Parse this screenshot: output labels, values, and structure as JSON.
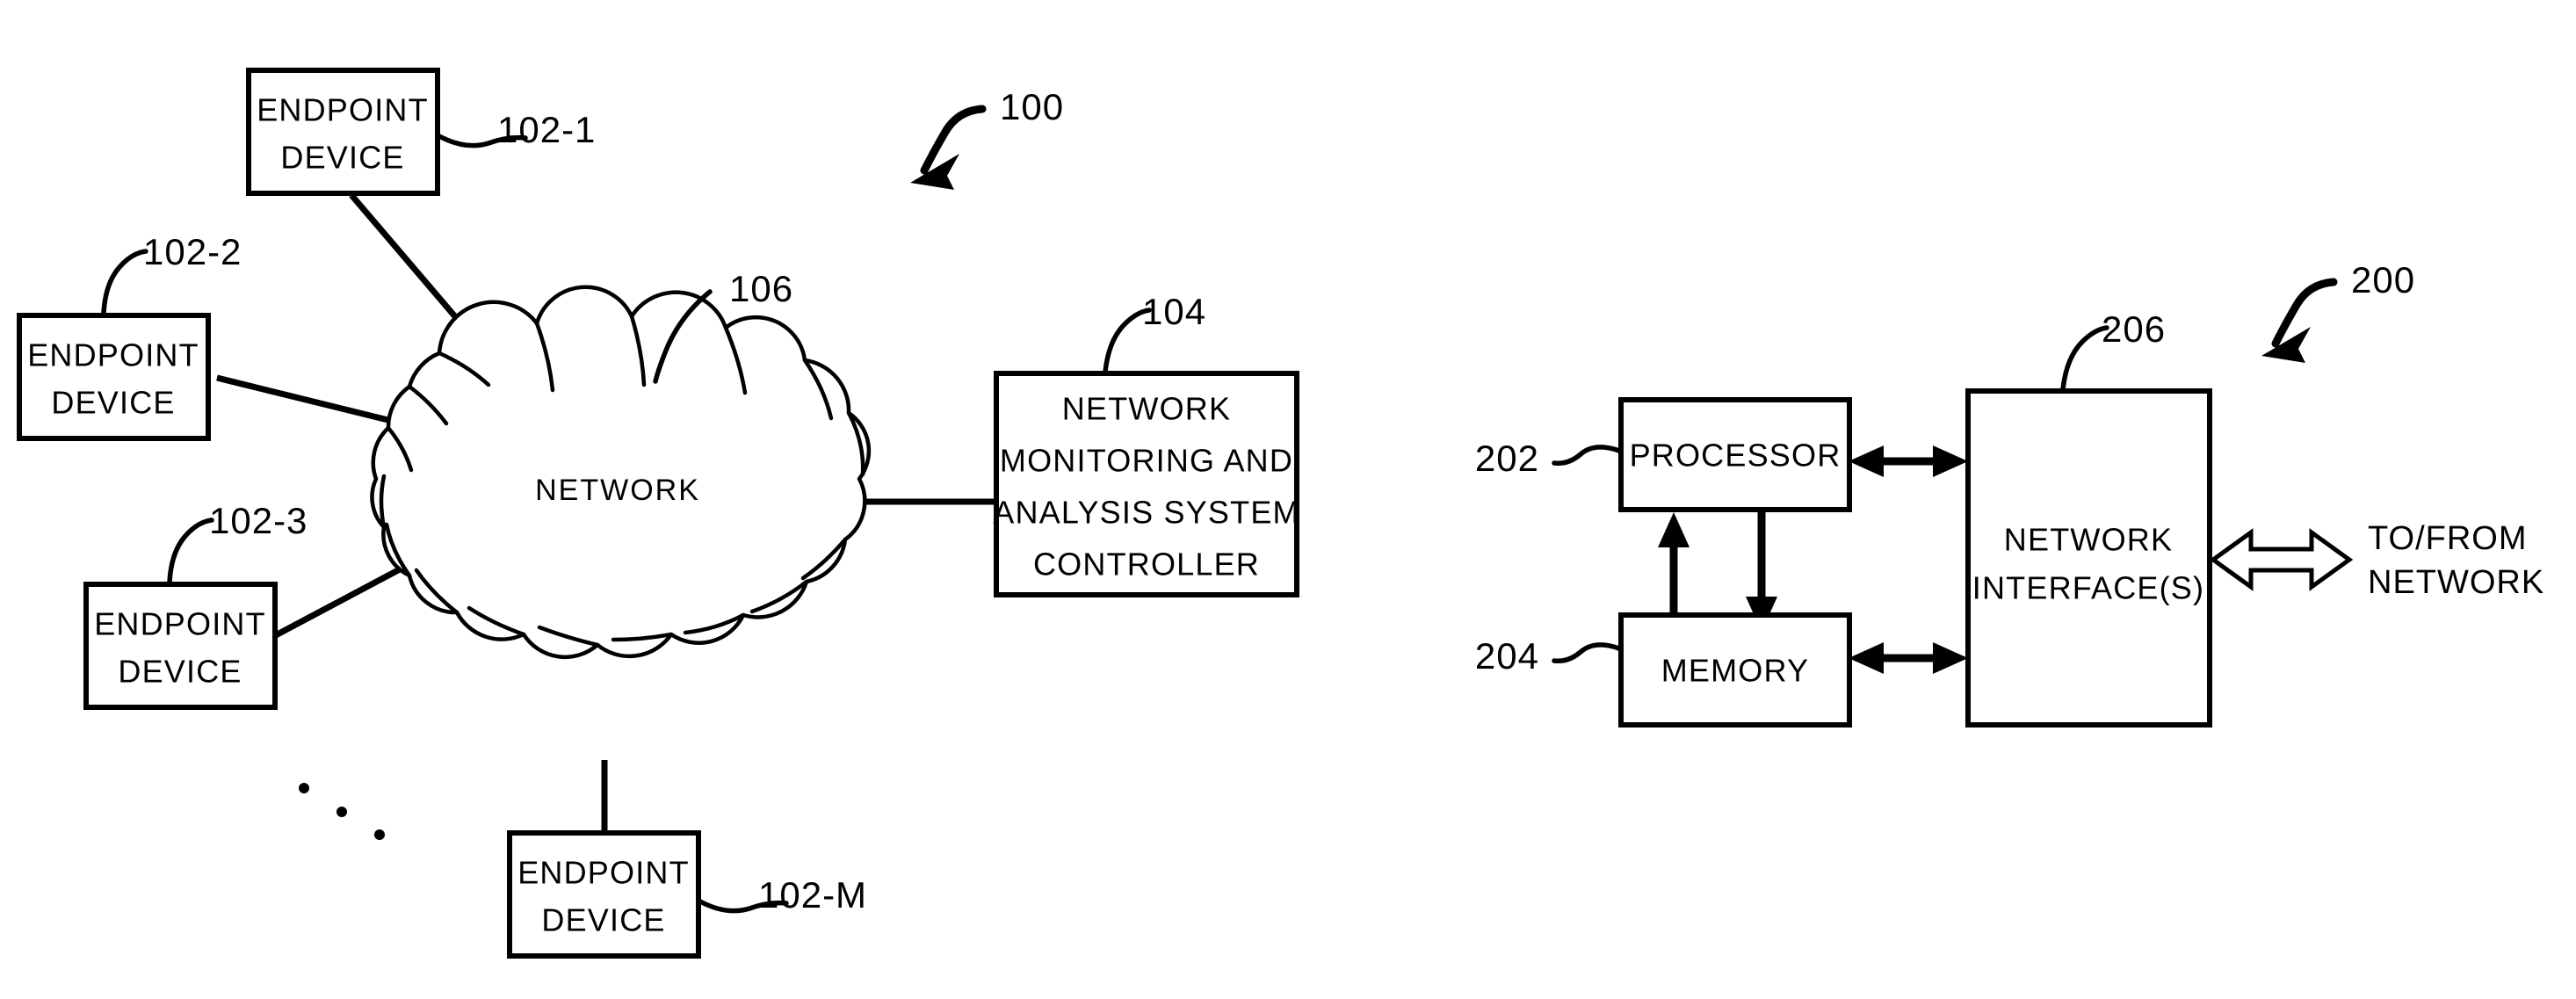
{
  "figure": {
    "title": "Network monitoring and analysis system patent figure",
    "background_color": "#ffffff",
    "ink_color": "#000000"
  },
  "fig1": {
    "marker": "100",
    "cloud": {
      "label": "NETWORK",
      "ref": "106"
    },
    "endpoints": [
      {
        "line1": "ENDPOINT",
        "line2": "DEVICE",
        "ref": "102-1"
      },
      {
        "line1": "ENDPOINT",
        "line2": "DEVICE",
        "ref": "102-2"
      },
      {
        "line1": "ENDPOINT",
        "line2": "DEVICE",
        "ref": "102-3"
      },
      {
        "line1": "ENDPOINT",
        "line2": "DEVICE",
        "ref": "102-M"
      }
    ],
    "controller": {
      "ref": "104",
      "lines": [
        "NETWORK",
        "MONITORING AND",
        "ANALYSIS SYSTEM",
        "CONTROLLER"
      ]
    },
    "ellipsis": "three-dots"
  },
  "fig2": {
    "marker": "200",
    "blocks": [
      {
        "label": "PROCESSOR",
        "ref": "202"
      },
      {
        "label": "MEMORY",
        "ref": "204"
      }
    ],
    "interface": {
      "ref": "206",
      "line1": "NETWORK",
      "line2": "INTERFACE(S)"
    },
    "external": {
      "line1": "TO/FROM",
      "line2": "NETWORK"
    }
  }
}
